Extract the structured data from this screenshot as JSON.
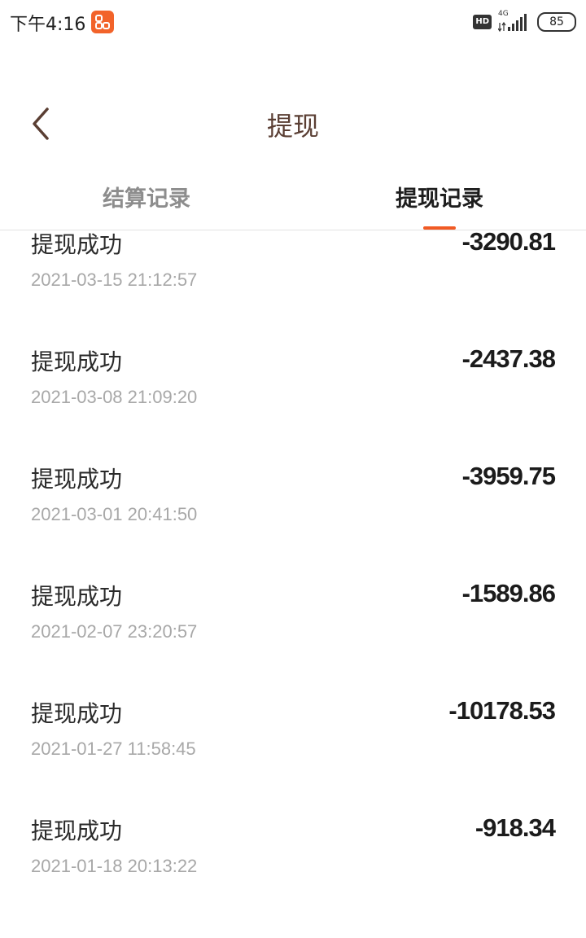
{
  "status_bar": {
    "time": "下午4:16",
    "hd": "HD",
    "network": "4G",
    "battery": "85"
  },
  "header": {
    "title": "提现"
  },
  "tabs": [
    {
      "label": "结算记录",
      "active": false
    },
    {
      "label": "提现记录",
      "active": true
    }
  ],
  "colors": {
    "accent": "#f15a24",
    "title": "#5a3e33"
  },
  "records": [
    {
      "status": "提现成功",
      "date": "2021-03-15 21:12:57",
      "amount": "-3290.81"
    },
    {
      "status": "提现成功",
      "date": "2021-03-08 21:09:20",
      "amount": "-2437.38"
    },
    {
      "status": "提现成功",
      "date": "2021-03-01 20:41:50",
      "amount": "-3959.75"
    },
    {
      "status": "提现成功",
      "date": "2021-02-07 23:20:57",
      "amount": "-1589.86"
    },
    {
      "status": "提现成功",
      "date": "2021-01-27 11:58:45",
      "amount": "-10178.53"
    },
    {
      "status": "提现成功",
      "date": "2021-01-18 20:13:22",
      "amount": "-918.34"
    }
  ]
}
